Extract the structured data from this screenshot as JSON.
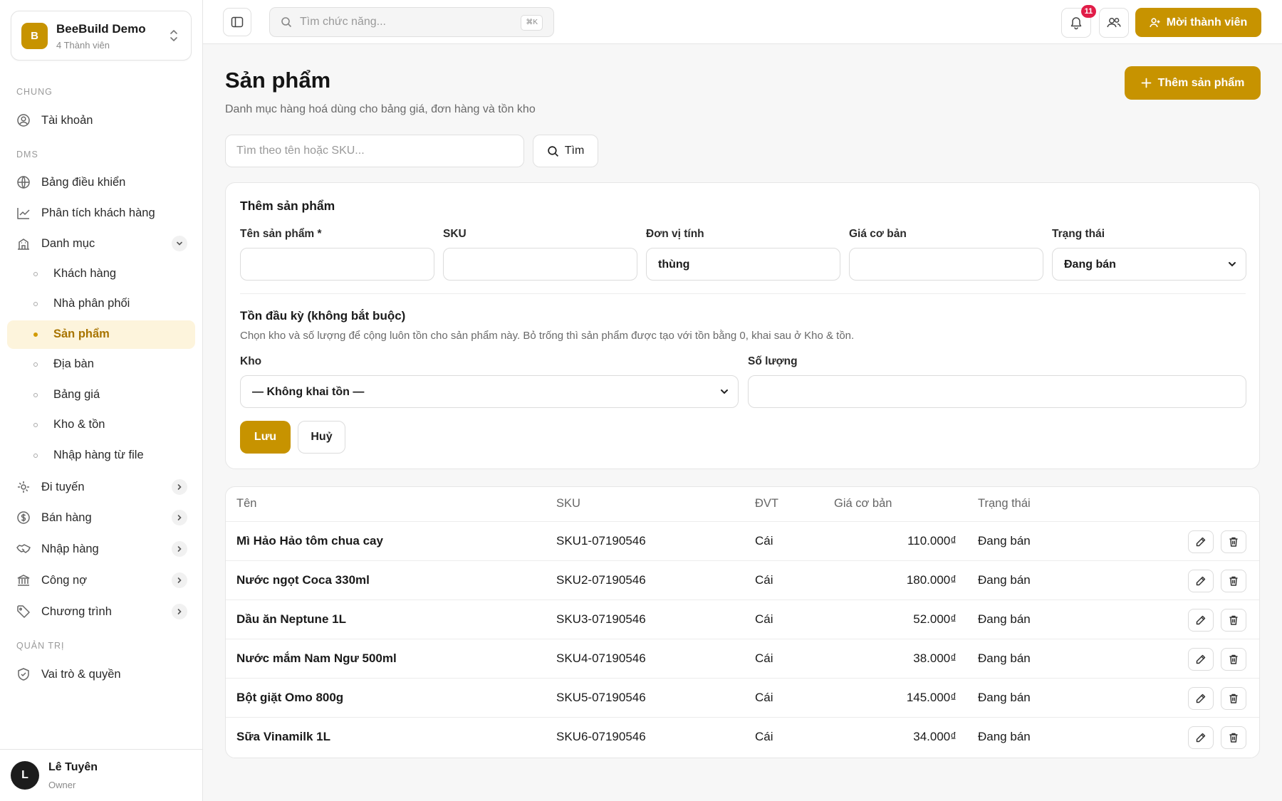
{
  "workspace": {
    "logo_letter": "B",
    "name": "BeeBuild Demo",
    "members": "4 Thành viên"
  },
  "sidebar": {
    "sections": {
      "general": "CHUNG",
      "dms": "DMS",
      "admin": "QUẢN TRỊ"
    },
    "account": "Tài khoản",
    "dashboard": "Bảng điều khiển",
    "customer_analytics": "Phân tích khách hàng",
    "catalog": "Danh mục",
    "catalog_items": [
      "Khách hàng",
      "Nhà phân phối",
      "Sản phẩm",
      "Địa bàn",
      "Bảng giá",
      "Kho & tồn",
      "Nhập hàng từ file"
    ],
    "routes": "Đi tuyến",
    "sales": "Bán hàng",
    "purchasing": "Nhập hàng",
    "debts": "Công nợ",
    "programs": "Chương trình",
    "roles": "Vai trò & quyền"
  },
  "user": {
    "initial": "L",
    "name": "Lê Tuyên",
    "role": "Owner"
  },
  "topbar": {
    "search_placeholder": "Tìm chức năng...",
    "shortcut": "⌘K",
    "notification_count": "11",
    "invite_label": "Mời thành viên"
  },
  "page": {
    "title": "Sản phẩm",
    "subtitle": "Danh mục hàng hoá dùng cho bảng giá, đơn hàng và tồn kho",
    "add_label": "Thêm sản phẩm",
    "search_placeholder": "Tìm theo tên hoặc SKU...",
    "find_label": "Tìm"
  },
  "form": {
    "title": "Thêm sản phẩm",
    "labels": {
      "name": "Tên sản phẩm *",
      "sku": "SKU",
      "unit": "Đơn vị tính",
      "base_price": "Giá cơ bản",
      "status": "Trạng thái",
      "warehouse": "Kho",
      "quantity": "Số lượng"
    },
    "values": {
      "name": "",
      "sku": "",
      "unit": "thùng",
      "base_price": "",
      "status": "Đang bán",
      "warehouse": "— Không khai tồn —",
      "quantity": ""
    },
    "opening_title": "Tồn đầu kỳ (không bắt buộc)",
    "opening_desc": "Chọn kho và số lượng để cộng luôn tồn cho sản phẩm này. Bỏ trống thì sản phẩm được tạo với tồn bằng 0, khai sau ở Kho & tồn.",
    "save_label": "Lưu",
    "cancel_label": "Huỷ"
  },
  "table": {
    "headers": [
      "Tên",
      "SKU",
      "ĐVT",
      "Giá cơ bản",
      "Trạng thái"
    ],
    "rows": [
      {
        "name": "Mì Hảo Hảo tôm chua cay",
        "sku": "SKU1-07190546",
        "unit": "Cái",
        "price": "110.000₫",
        "status": "Đang bán"
      },
      {
        "name": "Nước ngọt Coca 330ml",
        "sku": "SKU2-07190546",
        "unit": "Cái",
        "price": "180.000₫",
        "status": "Đang bán"
      },
      {
        "name": "Dầu ăn Neptune 1L",
        "sku": "SKU3-07190546",
        "unit": "Cái",
        "price": "52.000₫",
        "status": "Đang bán"
      },
      {
        "name": "Nước mắm Nam Ngư 500ml",
        "sku": "SKU4-07190546",
        "unit": "Cái",
        "price": "38.000₫",
        "status": "Đang bán"
      },
      {
        "name": "Bột giặt Omo 800g",
        "sku": "SKU5-07190546",
        "unit": "Cái",
        "price": "145.000₫",
        "status": "Đang bán"
      },
      {
        "name": "Sữa Vinamilk 1L",
        "sku": "SKU6-07190546",
        "unit": "Cái",
        "price": "34.000₫",
        "status": "Đang bán"
      }
    ]
  }
}
